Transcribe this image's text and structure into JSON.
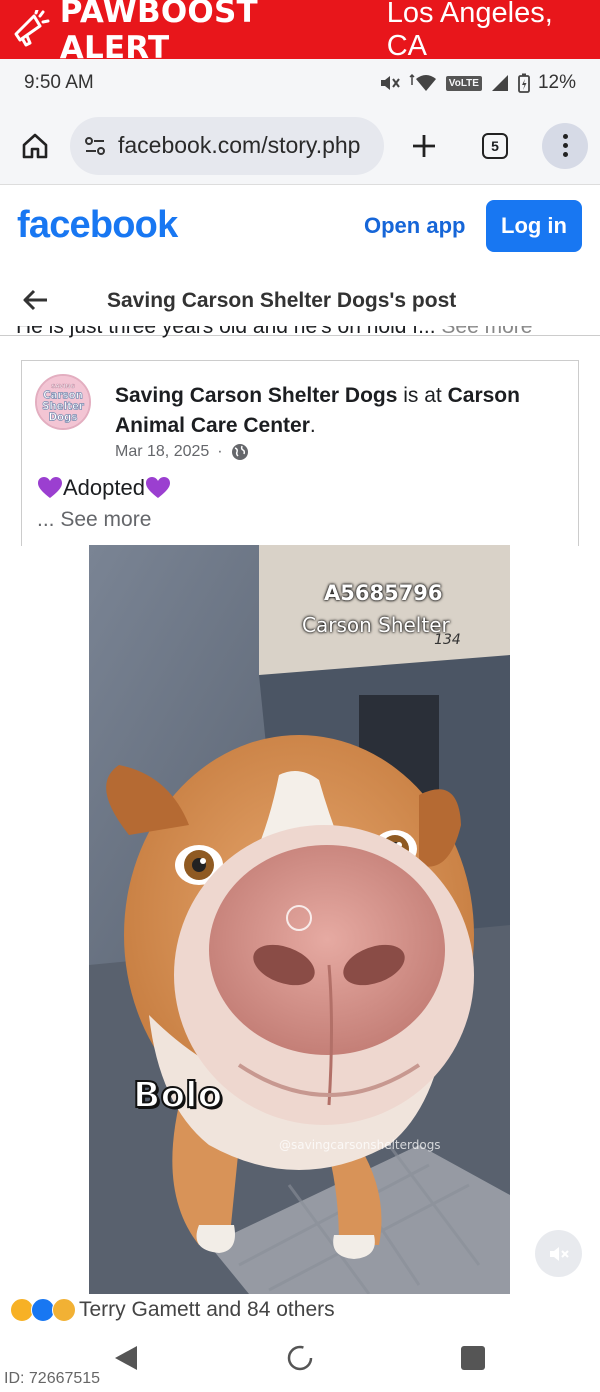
{
  "banner": {
    "brand": "PAWBOOST ALERT",
    "location": "Los Angeles, CA",
    "color": "#e8161b"
  },
  "status_bar": {
    "time": "9:50 AM",
    "network": "VoLTE",
    "battery": "12%"
  },
  "browser": {
    "url": "facebook.com/story.php",
    "tab_count": "5",
    "icons": [
      "home-icon",
      "site-settings-icon",
      "plus-icon",
      "tabs-icon",
      "more-menu-icon"
    ]
  },
  "facebook_header": {
    "logo": "facebook",
    "open_app_label": "Open app",
    "login_label": "Log in",
    "brand_color": "#1877f2"
  },
  "post_header": {
    "title": "Saving Carson Shelter Dogs's post"
  },
  "cut_text": {
    "text": "He is just three years old and he's on hold f...",
    "see_more": " See more"
  },
  "shared_post": {
    "avatar_text": "SAVING Carson Shelter Dogs",
    "author": "Saving Carson Shelter Dogs",
    "connector": " is at ",
    "place": "Carson Animal Care Center",
    "place_suffix": ".",
    "date": "Mar 18, 2025",
    "date_separator": "·",
    "status": "Adopted",
    "see_more": "... See more"
  },
  "video": {
    "animal_id": "A5685796",
    "shelter_caption": "Carson Shelter",
    "kennel_number": "134",
    "dog_name": "Bolo",
    "watermark": "@savingcarsonshelterdogs"
  },
  "reactions": {
    "text": "Terry Gamett and 84 others",
    "emojis": [
      "care-emoji",
      "like-emoji",
      "sad-emoji"
    ]
  },
  "footer": {
    "listing_id": "ID: 72667515"
  }
}
